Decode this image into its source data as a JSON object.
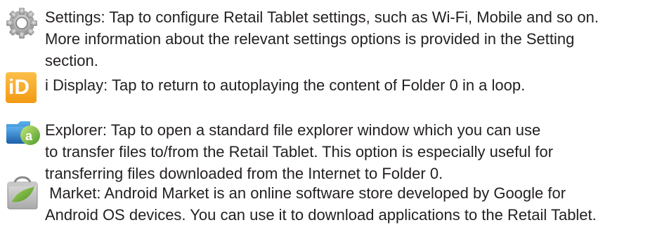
{
  "items": [
    {
      "name": "settings",
      "icon": "gear-icon",
      "lines": [
        "Settings: Tap to configure Retail Tablet settings, such as Wi-Fi, Mobile and so on.",
        "More information about the relevant settings options is provided in the Setting",
        "section."
      ]
    },
    {
      "name": "idisplay",
      "icon": "idisplay-icon",
      "icon_text": "iD",
      "lines": [
        "i Display: Tap to return to autoplaying the content of Folder 0 in a loop."
      ]
    },
    {
      "name": "explorer",
      "icon": "explorer-icon",
      "lines": [
        "Explorer: Tap to open a standard file explorer window which you can use",
        "to transfer files to/from the Retail Tablet. This option is especially useful for",
        "transferring files downloaded from the Internet to Folder 0."
      ]
    },
    {
      "name": "market",
      "icon": "market-bag-icon",
      "lines": [
        " Market: Android Market is an online software store developed by Google for",
        "Android OS devices. You can use it to download applications to the Retail Tablet."
      ]
    }
  ],
  "colors": {
    "text": "#231f20",
    "idisplay_orange": "#f7a21b",
    "explorer_blue": "#2a7ac6",
    "market_green": "#7cb342"
  }
}
